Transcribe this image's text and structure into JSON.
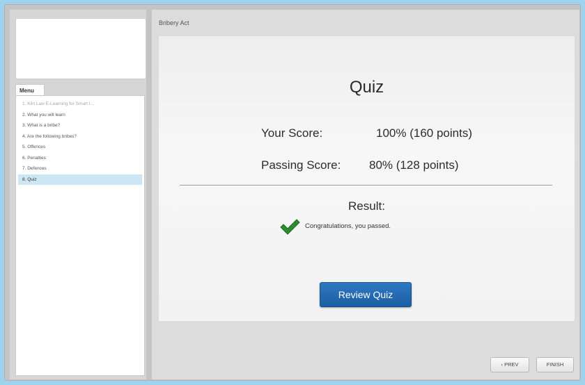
{
  "header": {
    "course_title": "Bribery Act"
  },
  "menu": {
    "tab_label": "Menu",
    "items": [
      {
        "label": "1. Kiln Law E-Learning for Smart I...",
        "state": "visited"
      },
      {
        "label": "2. What you will learn",
        "state": "normal"
      },
      {
        "label": "3. What is a bribe?",
        "state": "normal"
      },
      {
        "label": "4. Are the following bribes?",
        "state": "normal"
      },
      {
        "label": "5. Offences",
        "state": "normal"
      },
      {
        "label": "6. Penalties",
        "state": "normal"
      },
      {
        "label": "7. Defences",
        "state": "normal"
      },
      {
        "label": "8. Quiz",
        "state": "active"
      }
    ]
  },
  "quiz": {
    "title": "Quiz",
    "your_score_label": "Your Score:",
    "your_score_value": "100% (160 points)",
    "passing_score_label": "Passing Score:",
    "passing_score_value": "80% (128 points)",
    "result_label": "Result:",
    "result_message": "Congratulations, you passed.",
    "result_icon": "check-icon",
    "review_button": "Review Quiz"
  },
  "footer": {
    "prev_label": "‹ PREV",
    "finish_label": "FINISH"
  },
  "colors": {
    "accent_button": "#1f64ad",
    "check_green": "#2e8b2e",
    "active_menu": "#cde6f4",
    "page_border": "#9fd2ee"
  }
}
